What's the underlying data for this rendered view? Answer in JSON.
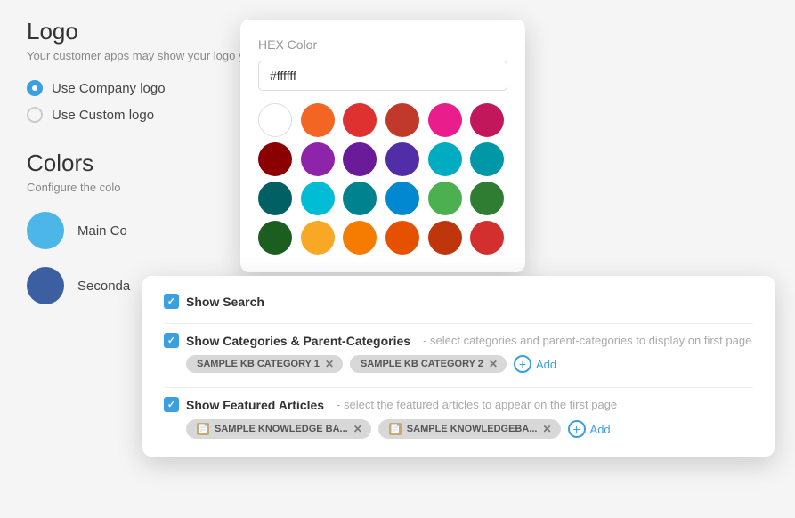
{
  "background": {
    "logo_title": "Logo",
    "logo_subtitle": "Your customer apps may show your logo y",
    "radio_options": [
      {
        "id": "company",
        "label": "Use Company logo",
        "selected": true
      },
      {
        "id": "custom",
        "label": "Use Custom logo",
        "selected": false
      }
    ],
    "colors_title": "Colors",
    "colors_subtitle": "Configure the colo",
    "color_rows": [
      {
        "id": "main",
        "label": "Main Co",
        "color": "#4db6e8"
      },
      {
        "id": "secondary",
        "label": "Seconda",
        "color": "#3b5fa0"
      }
    ]
  },
  "hex_picker": {
    "title": "HEX Color",
    "input_value": "#ffffff",
    "colors": [
      "#ffffff",
      "#f26522",
      "#e03131",
      "#c0392b",
      "#e91e8c",
      "#c2185b",
      "#8b0000",
      "#8e24aa",
      "#6a1b9a",
      "#512da8",
      "#00acc1",
      "#0097a7",
      "#006064",
      "#00bcd4",
      "#00838f",
      "#0288d1",
      "#2e7d32",
      "#388e3c",
      "#1b5e20",
      "#4caf50",
      "#2e7d32",
      "#33691e",
      "#f9a825",
      "#f57c00",
      "#e65100",
      "#bf360c",
      "#d32f2f",
      "#b71c1c"
    ]
  },
  "settings_card": {
    "show_search_label": "Show Search",
    "show_categories_label": "Show Categories & Parent-Categories",
    "show_categories_desc": "- select categories and parent-categories to display on first page",
    "categories": [
      {
        "label": "SAMPLE KB CATEGORY 1"
      },
      {
        "label": "SAMPLE KB CATEGORY 2"
      }
    ],
    "add_label": "Add",
    "show_articles_label": "Show Featured Articles",
    "show_articles_desc": "- select the featured articles to appear on the first page",
    "articles": [
      {
        "label": "SAMPLE KNOWLEDGE BA..."
      },
      {
        "label": "SAMPLE KNOWLEDGEBA..."
      }
    ]
  }
}
